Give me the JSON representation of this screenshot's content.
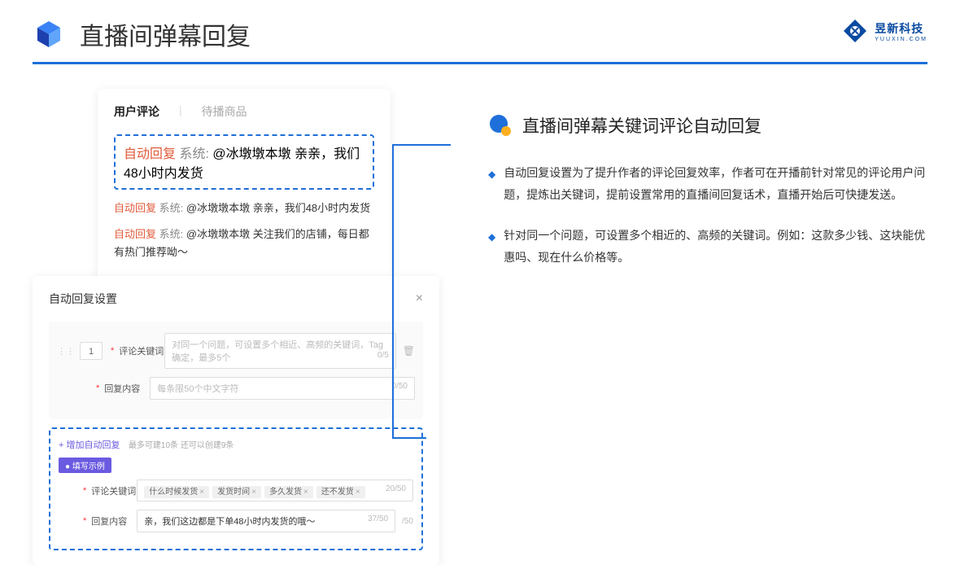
{
  "header": {
    "title": "直播间弹幕回复",
    "logo_cn": "昱新科技",
    "logo_en": "YUUXIN.COM"
  },
  "comments_panel": {
    "tab1": "用户评论",
    "tab2": "待播商品",
    "auto_label": "自动回复",
    "sys_label": "系统:",
    "msg1": "@冰墩墩本墩 亲亲，我们48小时内发货",
    "msg2": "@冰墩墩本墩 亲亲，我们48小时内发货",
    "msg3": "@冰墩墩本墩 关注我们的店铺，每日都有热门推荐呦～"
  },
  "settings_panel": {
    "title": "自动回复设置",
    "num": "1",
    "kw_label": "评论关键词",
    "kw_ph": "对同一个问题，可设置多个相近、高频的关键词，Tag确定，最多5个",
    "kw_count": "0/5",
    "content_label": "回复内容",
    "content_ph": "每条限50个中文字符",
    "content_count": "0/50",
    "add_link": "+ 增加自动回复",
    "add_sub": "最多可建10条 还可以创建9条",
    "badge": "● 填写示例",
    "ex_kw_label": "评论关键词",
    "tags": [
      "什么时候发货",
      "发货时间",
      "多久发货",
      "还不发货"
    ],
    "ex_kw_count": "20/50",
    "ex_content_label": "回复内容",
    "ex_content": "亲，我们这边都是下单48小时内发货的哦～",
    "ex_content_count": "37/50",
    "outer_count": "/50"
  },
  "right": {
    "section_title": "直播间弹幕关键词评论自动回复",
    "bullet1": "自动回复设置为了提升作者的评论回复效率，作者可在开播前针对常见的评论用户问题，提炼出关键词，提前设置常用的直播间回复话术，直播开始后可快捷发送。",
    "bullet2": "针对同一个问题，可设置多个相近的、高频的关键词。例如：这款多少钱、这块能优惠吗、现在什么价格等。"
  }
}
